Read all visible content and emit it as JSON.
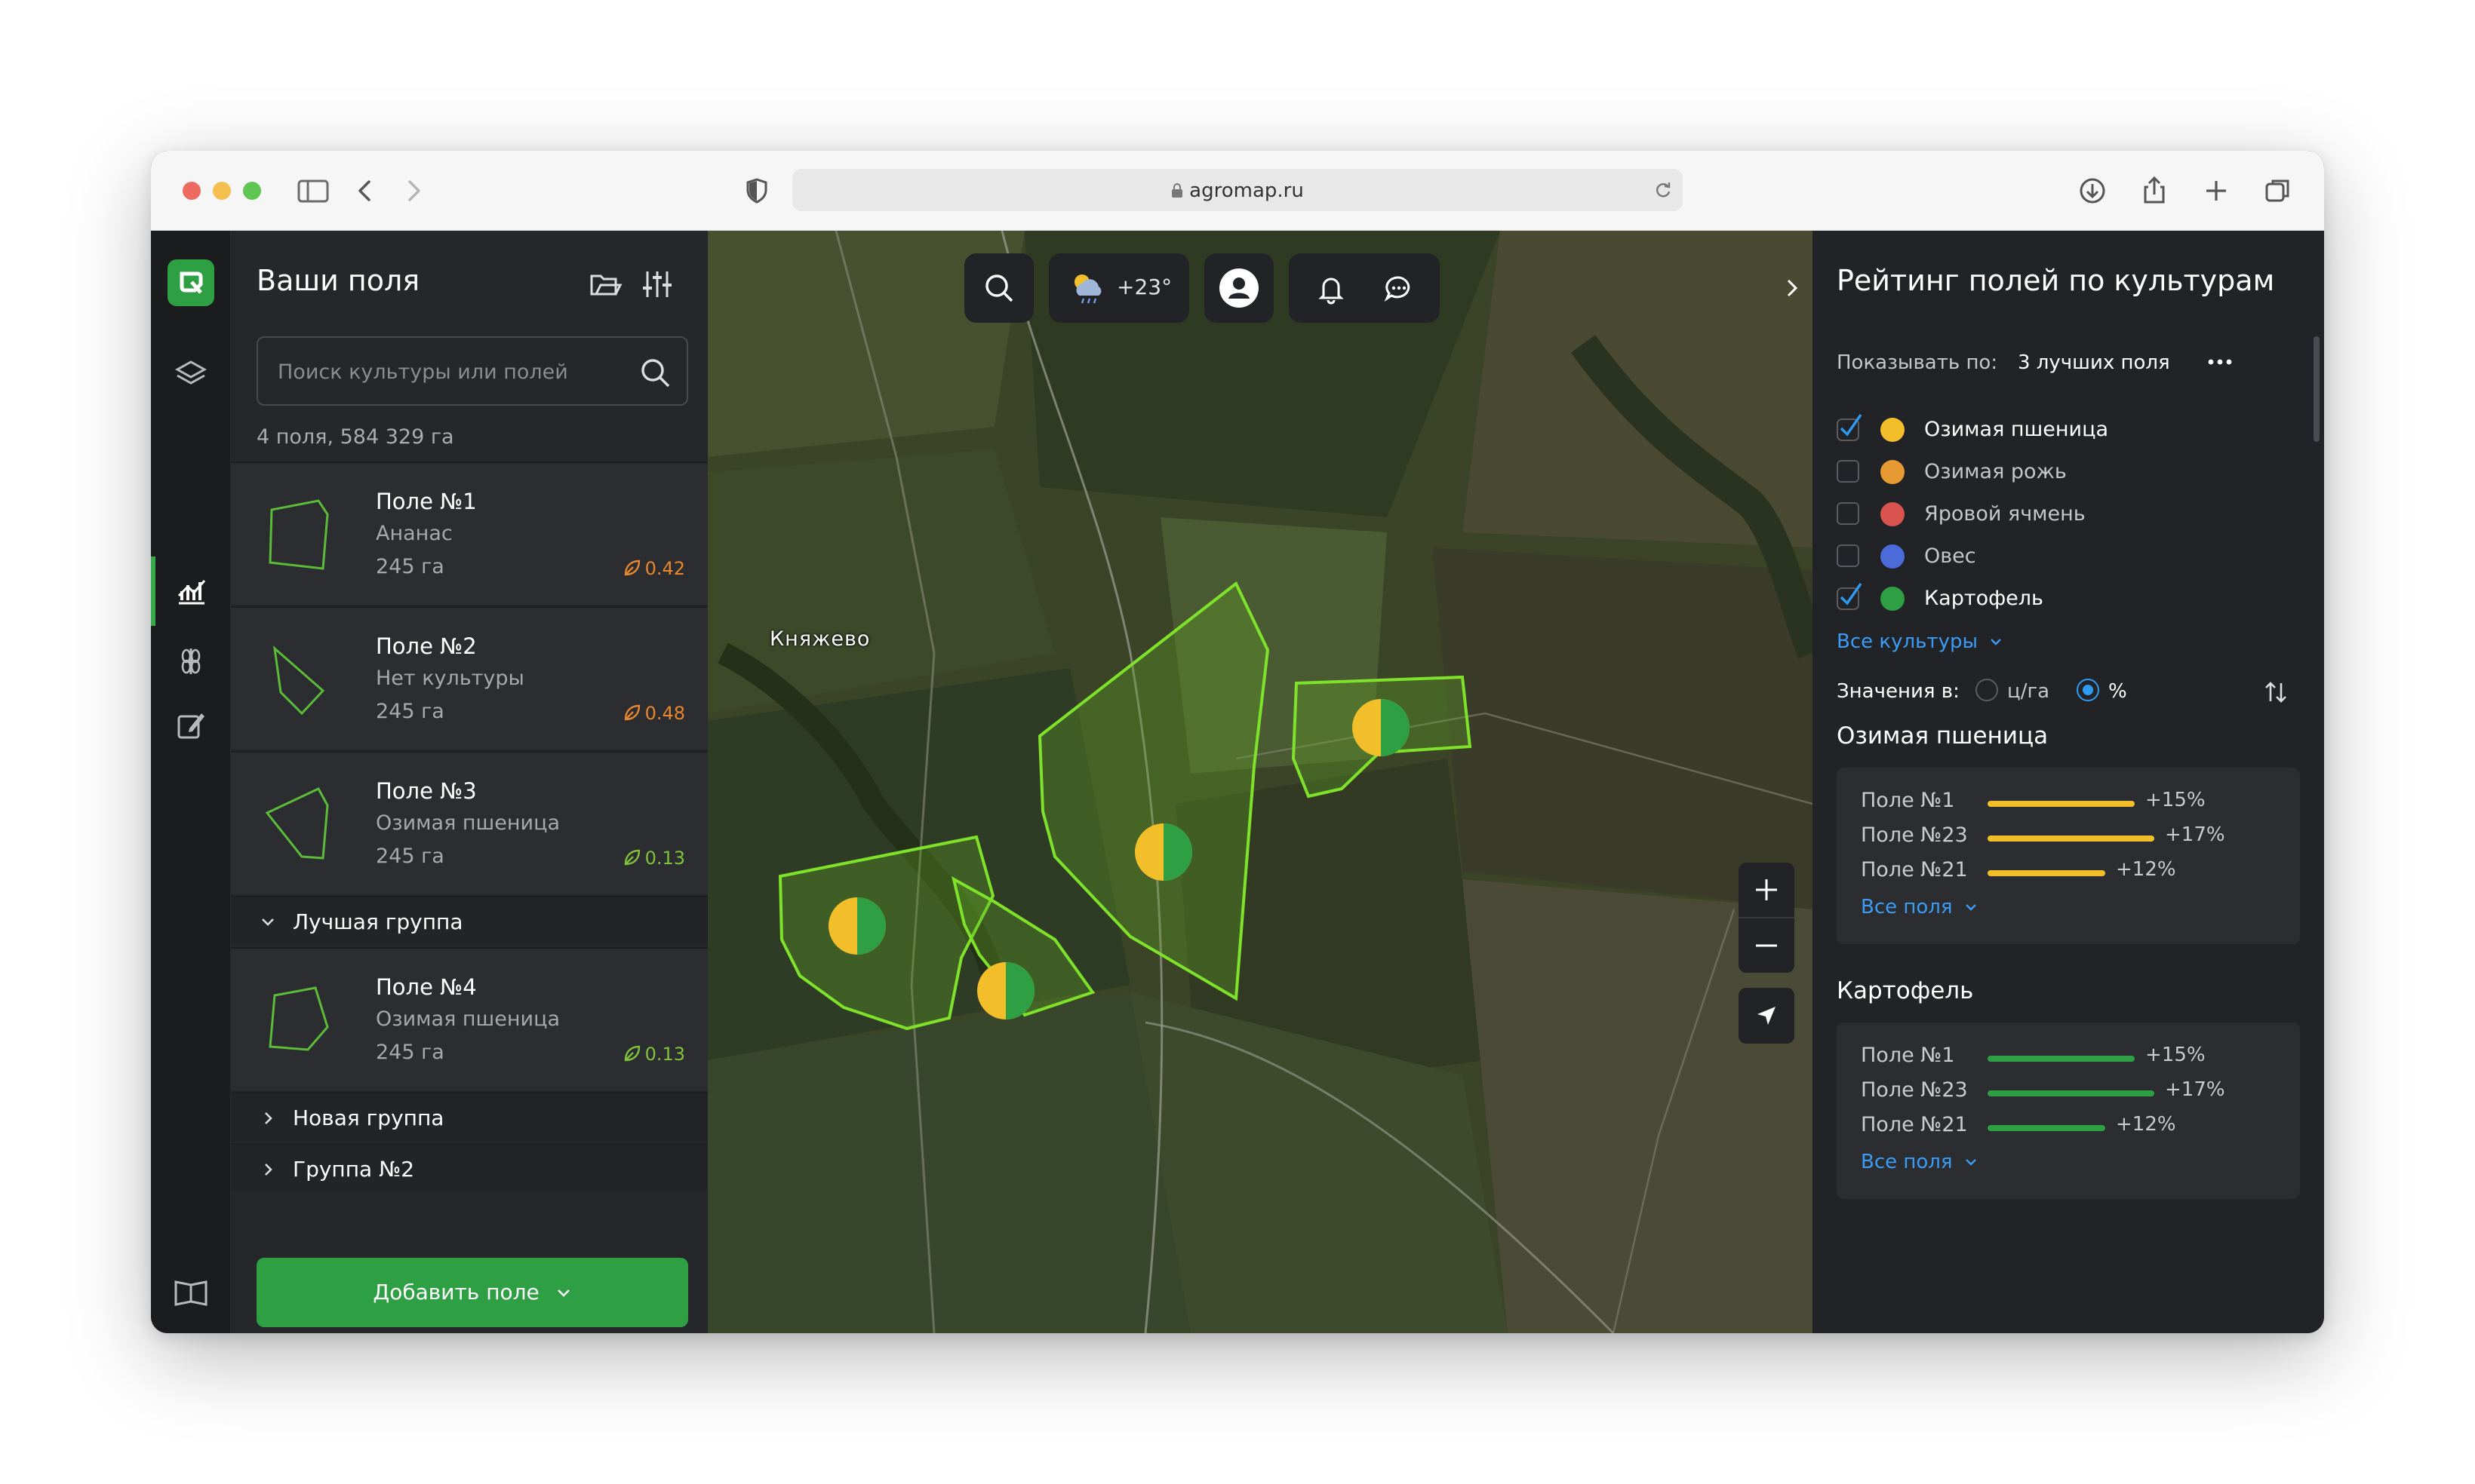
{
  "browser": {
    "url": "agromap.ru"
  },
  "sidebar": {
    "title": "Ваши поля",
    "search_placeholder": "Поиск культуры или полей",
    "summary": "4 поля, 584 329 га",
    "fields": [
      {
        "name": "Поле №1",
        "crop": "Ананас",
        "area": "245 га",
        "ndvi": "0.42",
        "ndvi_color": "#e8862d"
      },
      {
        "name": "Поле №2",
        "crop": "Нет культуры",
        "area": "245 га",
        "ndvi": "0.48",
        "ndvi_color": "#e8862d"
      },
      {
        "name": "Поле №3",
        "crop": "Озимая пшеница",
        "area": "245 га",
        "ndvi": "0.13",
        "ndvi_color": "#7fc23a"
      },
      {
        "name": "Поле №4",
        "crop": "Озимая пшеница",
        "area": "245 га",
        "ndvi": "0.13",
        "ndvi_color": "#7fc23a"
      }
    ],
    "groups": [
      "Лучшая группа",
      "Новая группа",
      "Группа №2"
    ],
    "add_button": "Добавить поле"
  },
  "map": {
    "village_label": "Княжево",
    "weather_temp": "+23°"
  },
  "rating": {
    "title": "Рейтинг полей по культурам",
    "show_by_label": "Показывать по:",
    "show_by_value": "3 лучших поля",
    "crops": [
      {
        "name": "Озимая пшеница",
        "color": "#f2bf2b",
        "checked": true
      },
      {
        "name": "Озимая рожь",
        "color": "#e89a32",
        "checked": false
      },
      {
        "name": "Яровой ячмень",
        "color": "#d9534f",
        "checked": false
      },
      {
        "name": "Овес",
        "color": "#4a6bd8",
        "checked": false
      },
      {
        "name": "Картофель",
        "color": "#2ea043",
        "checked": true
      }
    ],
    "all_crops": "Все культуры",
    "values_label": "Значения в:",
    "unit_a": "ц/га",
    "unit_b": "%",
    "sections": [
      {
        "title": "Озимая пшеница",
        "color": "#f2bf2b",
        "rows": [
          {
            "name": "Поле №1",
            "value": 15,
            "pct": "+15%"
          },
          {
            "name": "Поле №23",
            "value": 17,
            "pct": "+17%"
          },
          {
            "name": "Поле №21",
            "value": 12,
            "pct": "+12%"
          }
        ],
        "all": "Все поля"
      },
      {
        "title": "Картофель",
        "color": "#2ea043",
        "rows": [
          {
            "name": "Поле №1",
            "value": 15,
            "pct": "+15%"
          },
          {
            "name": "Поле №23",
            "value": 17,
            "pct": "+17%"
          },
          {
            "name": "Поле №21",
            "value": 12,
            "pct": "+12%"
          }
        ],
        "all": "Все поля"
      }
    ]
  }
}
